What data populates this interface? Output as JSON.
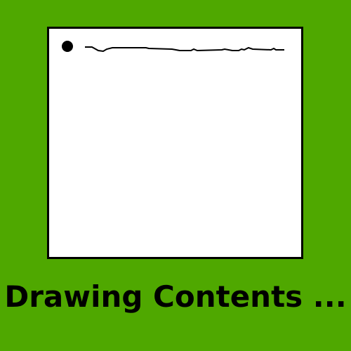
{
  "caption": "Drawing Contents ...",
  "colors": {
    "background": "#4fa800",
    "canvas": "#ffffff",
    "ink": "#000000"
  }
}
